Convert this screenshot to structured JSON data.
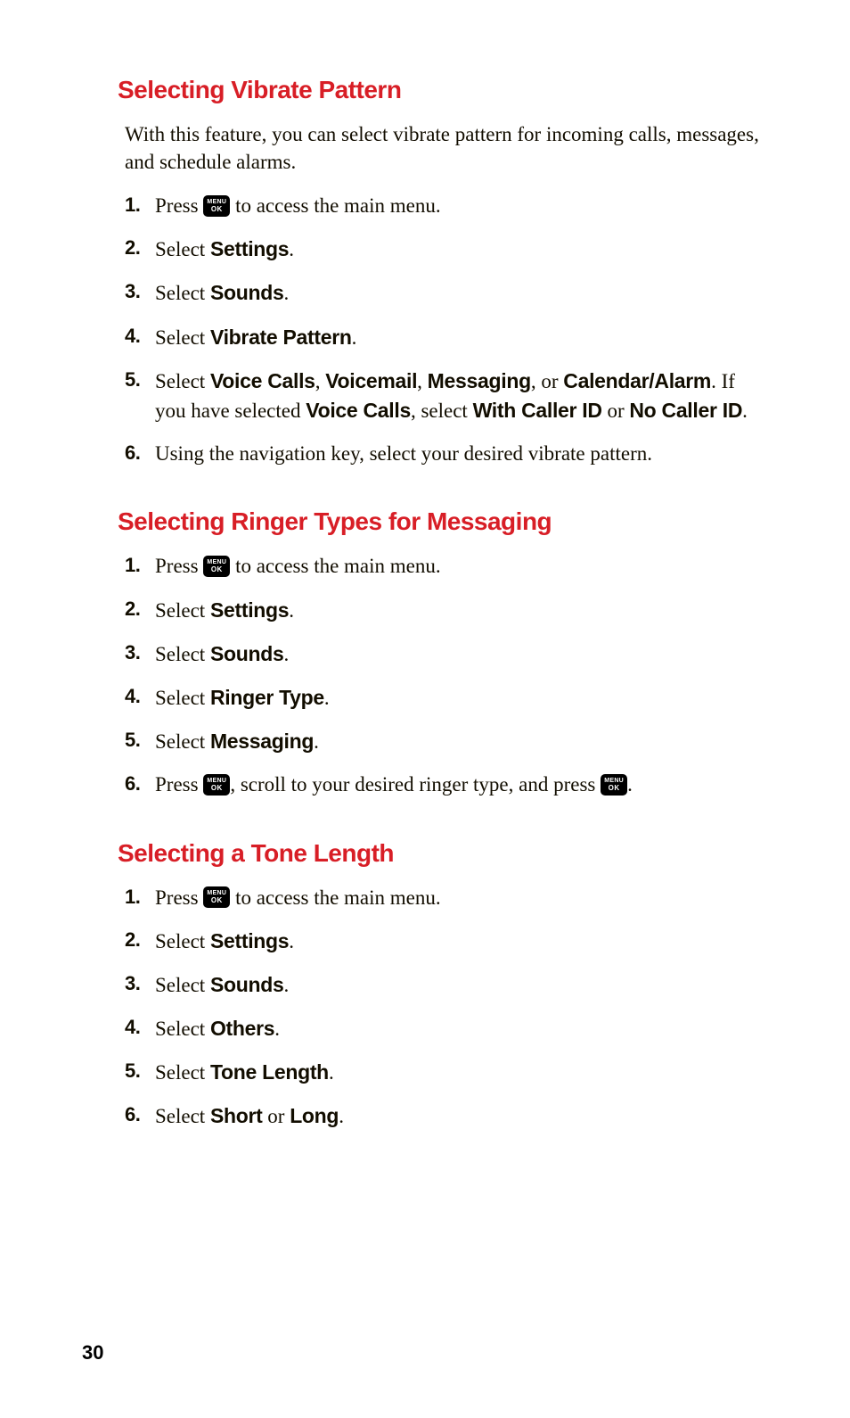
{
  "pageNumber": "30",
  "icon": {
    "top": "MENU",
    "bottom": "OK"
  },
  "sections": [
    {
      "heading": "Selecting Vibrate Pattern",
      "intro": "With this feature, you can select vibrate pattern for incoming calls, messages, and schedule alarms.",
      "steps": [
        {
          "num": "1.",
          "parts": [
            {
              "t": "text",
              "v": "Press "
            },
            {
              "t": "icon"
            },
            {
              "t": "text",
              "v": " to access the main menu."
            }
          ]
        },
        {
          "num": "2.",
          "parts": [
            {
              "t": "text",
              "v": "Select "
            },
            {
              "t": "bold",
              "v": "Settings"
            },
            {
              "t": "text",
              "v": "."
            }
          ]
        },
        {
          "num": "3.",
          "parts": [
            {
              "t": "text",
              "v": "Select "
            },
            {
              "t": "bold",
              "v": "Sounds"
            },
            {
              "t": "text",
              "v": "."
            }
          ]
        },
        {
          "num": "4.",
          "parts": [
            {
              "t": "text",
              "v": "Select "
            },
            {
              "t": "bold",
              "v": "Vibrate Pattern"
            },
            {
              "t": "text",
              "v": "."
            }
          ]
        },
        {
          "num": "5.",
          "parts": [
            {
              "t": "text",
              "v": "Select "
            },
            {
              "t": "bold",
              "v": "Voice Calls"
            },
            {
              "t": "text",
              "v": ", "
            },
            {
              "t": "bold",
              "v": "Voicemail"
            },
            {
              "t": "text",
              "v": ", "
            },
            {
              "t": "bold",
              "v": "Messaging"
            },
            {
              "t": "text",
              "v": ", or "
            },
            {
              "t": "bold",
              "v": "Calendar/Alarm"
            },
            {
              "t": "text",
              "v": ". If you have selected "
            },
            {
              "t": "bold",
              "v": "Voice Calls"
            },
            {
              "t": "text",
              "v": ", select "
            },
            {
              "t": "bold",
              "v": "With Caller ID"
            },
            {
              "t": "text",
              "v": " or "
            },
            {
              "t": "bold",
              "v": "No Caller ID"
            },
            {
              "t": "text",
              "v": "."
            }
          ]
        },
        {
          "num": "6.",
          "parts": [
            {
              "t": "text",
              "v": "Using the navigation key, select your desired vibrate pattern."
            }
          ]
        }
      ]
    },
    {
      "heading": "Selecting Ringer Types for Messaging",
      "steps": [
        {
          "num": "1.",
          "parts": [
            {
              "t": "text",
              "v": "Press "
            },
            {
              "t": "icon"
            },
            {
              "t": "text",
              "v": " to access the main menu."
            }
          ]
        },
        {
          "num": "2.",
          "parts": [
            {
              "t": "text",
              "v": "Select "
            },
            {
              "t": "bold",
              "v": "Settings"
            },
            {
              "t": "text",
              "v": "."
            }
          ]
        },
        {
          "num": "3.",
          "parts": [
            {
              "t": "text",
              "v": "Select "
            },
            {
              "t": "bold",
              "v": "Sounds"
            },
            {
              "t": "text",
              "v": "."
            }
          ]
        },
        {
          "num": "4.",
          "parts": [
            {
              "t": "text",
              "v": "Select "
            },
            {
              "t": "bold",
              "v": "Ringer Type"
            },
            {
              "t": "text",
              "v": "."
            }
          ]
        },
        {
          "num": "5.",
          "parts": [
            {
              "t": "text",
              "v": "Select "
            },
            {
              "t": "bold",
              "v": "Messaging"
            },
            {
              "t": "text",
              "v": "."
            }
          ]
        },
        {
          "num": "6.",
          "parts": [
            {
              "t": "text",
              "v": "Press "
            },
            {
              "t": "icon"
            },
            {
              "t": "text",
              "v": ", scroll to your desired ringer type, and press "
            },
            {
              "t": "icon"
            },
            {
              "t": "text",
              "v": "."
            }
          ]
        }
      ]
    },
    {
      "heading": "Selecting a Tone Length",
      "steps": [
        {
          "num": "1.",
          "parts": [
            {
              "t": "text",
              "v": "Press "
            },
            {
              "t": "icon"
            },
            {
              "t": "text",
              "v": " to access the main menu."
            }
          ]
        },
        {
          "num": "2.",
          "parts": [
            {
              "t": "text",
              "v": "Select "
            },
            {
              "t": "bold",
              "v": "Settings"
            },
            {
              "t": "text",
              "v": "."
            }
          ]
        },
        {
          "num": "3.",
          "parts": [
            {
              "t": "text",
              "v": "Select "
            },
            {
              "t": "bold",
              "v": "Sounds"
            },
            {
              "t": "text",
              "v": "."
            }
          ]
        },
        {
          "num": "4.",
          "parts": [
            {
              "t": "text",
              "v": "Select "
            },
            {
              "t": "bold",
              "v": "Others"
            },
            {
              "t": "text",
              "v": "."
            }
          ]
        },
        {
          "num": "5.",
          "parts": [
            {
              "t": "text",
              "v": "Select "
            },
            {
              "t": "bold",
              "v": "Tone Length"
            },
            {
              "t": "text",
              "v": "."
            }
          ]
        },
        {
          "num": "6.",
          "parts": [
            {
              "t": "text",
              "v": "Select "
            },
            {
              "t": "bold",
              "v": "Short"
            },
            {
              "t": "text",
              "v": " or "
            },
            {
              "t": "bold",
              "v": "Long"
            },
            {
              "t": "text",
              "v": "."
            }
          ]
        }
      ]
    }
  ]
}
